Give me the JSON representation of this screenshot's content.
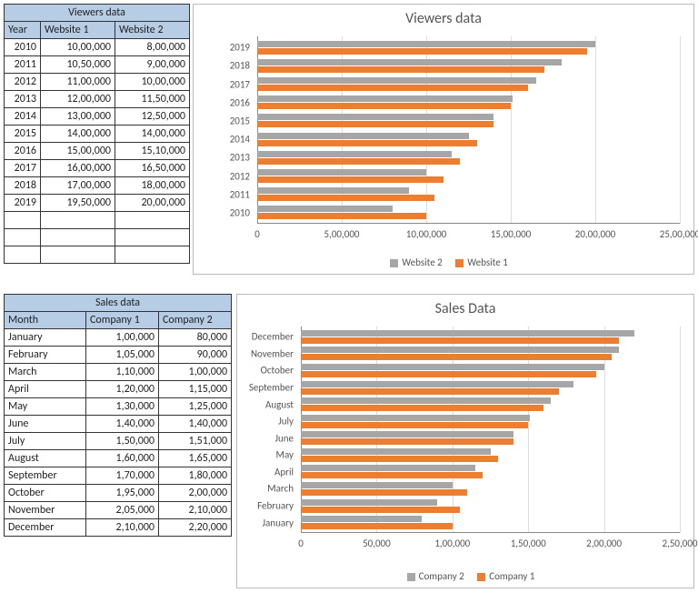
{
  "table1": {
    "title": "Viewers data",
    "headers": [
      "Year",
      "Website 1",
      "Website 2"
    ],
    "rows": [
      [
        "2010",
        "10,00,000",
        "8,00,000"
      ],
      [
        "2011",
        "10,50,000",
        "9,00,000"
      ],
      [
        "2012",
        "11,00,000",
        "10,00,000"
      ],
      [
        "2013",
        "12,00,000",
        "11,50,000"
      ],
      [
        "2014",
        "13,00,000",
        "12,50,000"
      ],
      [
        "2015",
        "14,00,000",
        "14,00,000"
      ],
      [
        "2016",
        "15,00,000",
        "15,10,000"
      ],
      [
        "2017",
        "16,00,000",
        "16,50,000"
      ],
      [
        "2018",
        "17,00,000",
        "18,00,000"
      ],
      [
        "2019",
        "19,50,000",
        "20,00,000"
      ]
    ]
  },
  "table2": {
    "title": "Sales data",
    "headers": [
      "Month",
      "Company 1",
      "Company 2"
    ],
    "rows": [
      [
        "January",
        "1,00,000",
        "80,000"
      ],
      [
        "February",
        "1,05,000",
        "90,000"
      ],
      [
        "March",
        "1,10,000",
        "1,00,000"
      ],
      [
        "April",
        "1,20,000",
        "1,15,000"
      ],
      [
        "May",
        "1,30,000",
        "1,25,000"
      ],
      [
        "June",
        "1,40,000",
        "1,40,000"
      ],
      [
        "July",
        "1,50,000",
        "1,51,000"
      ],
      [
        "August",
        "1,60,000",
        "1,65,000"
      ],
      [
        "September",
        "1,70,000",
        "1,80,000"
      ],
      [
        "October",
        "1,95,000",
        "2,00,000"
      ],
      [
        "November",
        "2,05,000",
        "2,10,000"
      ],
      [
        "December",
        "2,10,000",
        "2,20,000"
      ]
    ]
  },
  "chart1": {
    "title": "Viewers data",
    "legend": [
      "Website 2",
      "Website 1"
    ],
    "xticks": [
      "0",
      "5,00,000",
      "10,00,000",
      "15,00,000",
      "20,00,000",
      "25,00,000"
    ]
  },
  "chart2": {
    "title": "Sales Data",
    "legend": [
      "Company 2",
      "Company 1"
    ],
    "xticks": [
      "0",
      "50,000",
      "1,00,000",
      "1,50,000",
      "2,00,000",
      "2,50,000"
    ]
  },
  "chart_data": [
    {
      "type": "bar",
      "orientation": "horizontal",
      "title": "Viewers data",
      "categories": [
        "2010",
        "2011",
        "2012",
        "2013",
        "2014",
        "2015",
        "2016",
        "2017",
        "2018",
        "2019"
      ],
      "series": [
        {
          "name": "Website 2",
          "color": "#a6a6a6",
          "values": [
            800000,
            900000,
            1000000,
            1150000,
            1250000,
            1400000,
            1510000,
            1650000,
            1800000,
            2000000
          ]
        },
        {
          "name": "Website 1",
          "color": "#ed7d31",
          "values": [
            1000000,
            1050000,
            1100000,
            1200000,
            1300000,
            1400000,
            1500000,
            1600000,
            1700000,
            1950000
          ]
        }
      ],
      "xlabel": "",
      "ylabel": "",
      "xlim": [
        0,
        2500000
      ],
      "xticks": [
        0,
        500000,
        1000000,
        1500000,
        2000000,
        2500000
      ],
      "legend_position": "bottom",
      "grid": true
    },
    {
      "type": "bar",
      "orientation": "horizontal",
      "title": "Sales Data",
      "categories": [
        "January",
        "February",
        "March",
        "April",
        "May",
        "June",
        "July",
        "August",
        "September",
        "October",
        "November",
        "December"
      ],
      "series": [
        {
          "name": "Company 2",
          "color": "#a6a6a6",
          "values": [
            80000,
            90000,
            100000,
            115000,
            125000,
            140000,
            151000,
            165000,
            180000,
            200000,
            210000,
            220000
          ]
        },
        {
          "name": "Company 1",
          "color": "#ed7d31",
          "values": [
            100000,
            105000,
            110000,
            120000,
            130000,
            140000,
            150000,
            160000,
            170000,
            195000,
            205000,
            210000
          ]
        }
      ],
      "xlabel": "",
      "ylabel": "",
      "xlim": [
        0,
        250000
      ],
      "xticks": [
        0,
        50000,
        100000,
        150000,
        200000,
        250000
      ],
      "legend_position": "bottom",
      "grid": true
    }
  ]
}
